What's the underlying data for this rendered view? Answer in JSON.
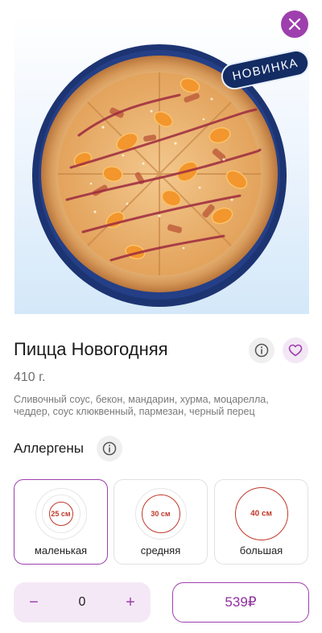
{
  "product": {
    "badge": "НОВИНКА",
    "title": "Пицца Новогодняя",
    "weight": "410 г.",
    "description": "Сливочный соус, бекон, мандарин, хурма, моцарелла, чеддер, соус клюквенный, пармезан, черный перец"
  },
  "allergens": {
    "label": "Аллергены"
  },
  "sizes": [
    {
      "diameter": "25 см",
      "label": "маленькая",
      "selected": true
    },
    {
      "diameter": "30 см",
      "label": "средняя",
      "selected": false
    },
    {
      "diameter": "40 см",
      "label": "большая",
      "selected": false
    }
  ],
  "order": {
    "minus": "−",
    "quantity": "0",
    "plus": "+",
    "price": "539₽"
  },
  "colors": {
    "accent": "#9e3fae",
    "accent_light": "#f4e8f6",
    "plate": "#1d3472",
    "size_text": "#c0392b"
  },
  "icons": {
    "close": "close-icon",
    "info": "info-icon",
    "favorite": "heart-icon"
  }
}
